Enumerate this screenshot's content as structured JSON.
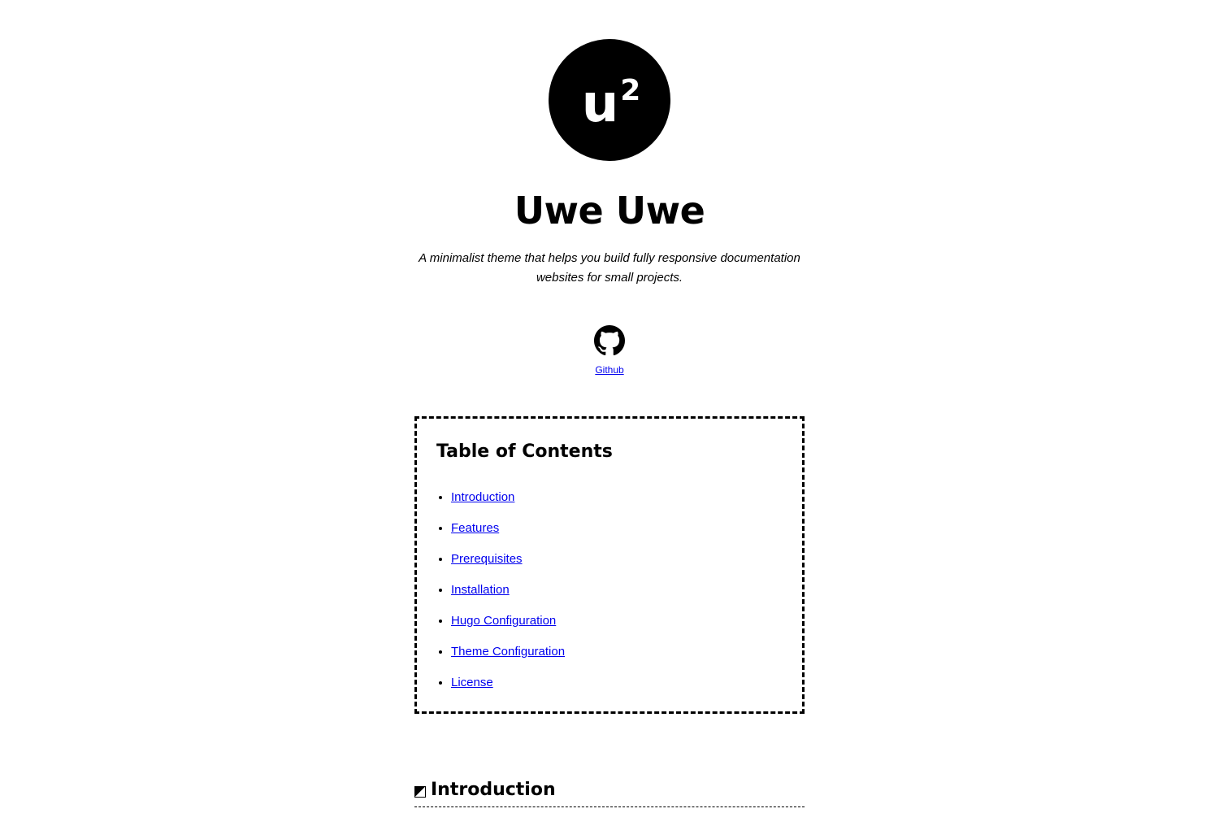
{
  "header": {
    "logo_text": "u",
    "logo_sup": "2",
    "title": "Uwe Uwe",
    "tagline": "A minimalist theme that helps you build fully responsive documentation websites for small projects."
  },
  "links": {
    "github_label": "Github",
    "github_icon": "github-icon"
  },
  "toc": {
    "title": "Table of Contents",
    "items": [
      {
        "label": "Introduction"
      },
      {
        "label": "Features"
      },
      {
        "label": "Prerequisites"
      },
      {
        "label": "Installation"
      },
      {
        "label": "Hugo Configuration"
      },
      {
        "label": "Theme Configuration"
      },
      {
        "label": "License"
      }
    ]
  },
  "sections": [
    {
      "title": "Introduction",
      "icon": "half-square-icon"
    }
  ],
  "colors": {
    "link": "#0000ee",
    "text": "#000000",
    "background": "#ffffff"
  }
}
